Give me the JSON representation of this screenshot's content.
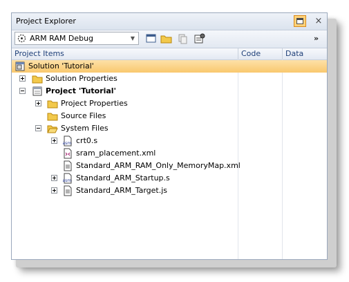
{
  "window": {
    "title": "Project Explorer",
    "close_glyph": "×"
  },
  "toolbar": {
    "configuration": "ARM RAM Debug",
    "overflow_glyph": "»",
    "tools": [
      "new-window-icon",
      "folder-icon",
      "disabled-copy-icon",
      "properties-icon"
    ]
  },
  "columns": {
    "items": "Project Items",
    "code": "Code",
    "data": "Data"
  },
  "tree": [
    {
      "label": "Solution 'Tutorial'",
      "icon": "solution-icon",
      "bold": false,
      "selected": true,
      "expander": null
    },
    {
      "label": "Solution Properties",
      "icon": "folder-icon",
      "bold": false,
      "selected": false,
      "expander": "plus"
    },
    {
      "label": "Project 'Tutorial'",
      "icon": "project-icon",
      "bold": true,
      "selected": false,
      "expander": "minus"
    },
    {
      "label": "Project Properties",
      "icon": "folder-icon",
      "bold": false,
      "selected": false,
      "expander": "plus"
    },
    {
      "label": "Source Files",
      "icon": "folder-icon",
      "bold": false,
      "selected": false,
      "expander": null
    },
    {
      "label": "System Files",
      "icon": "folder-open-icon",
      "bold": false,
      "selected": false,
      "expander": "minus"
    },
    {
      "label": "crt0.s",
      "icon": "asm-file-icon",
      "bold": false,
      "selected": false,
      "expander": "plus"
    },
    {
      "label": "sram_placement.xml",
      "icon": "xml-file-icon",
      "bold": false,
      "selected": false,
      "expander": null
    },
    {
      "label": "Standard_ARM_RAM_Only_MemoryMap.xml",
      "icon": "text-file-icon",
      "bold": false,
      "selected": false,
      "expander": null
    },
    {
      "label": "Standard_ARM_Startup.s",
      "icon": "asm-file-icon",
      "bold": false,
      "selected": false,
      "expander": "plus"
    },
    {
      "label": "Standard_ARM_Target.js",
      "icon": "text-file-icon",
      "bold": false,
      "selected": false,
      "expander": "plus"
    }
  ],
  "colors": {
    "selection": "#f9c86e",
    "header_text": "#1e3f78",
    "folder": "#f2c94c"
  }
}
